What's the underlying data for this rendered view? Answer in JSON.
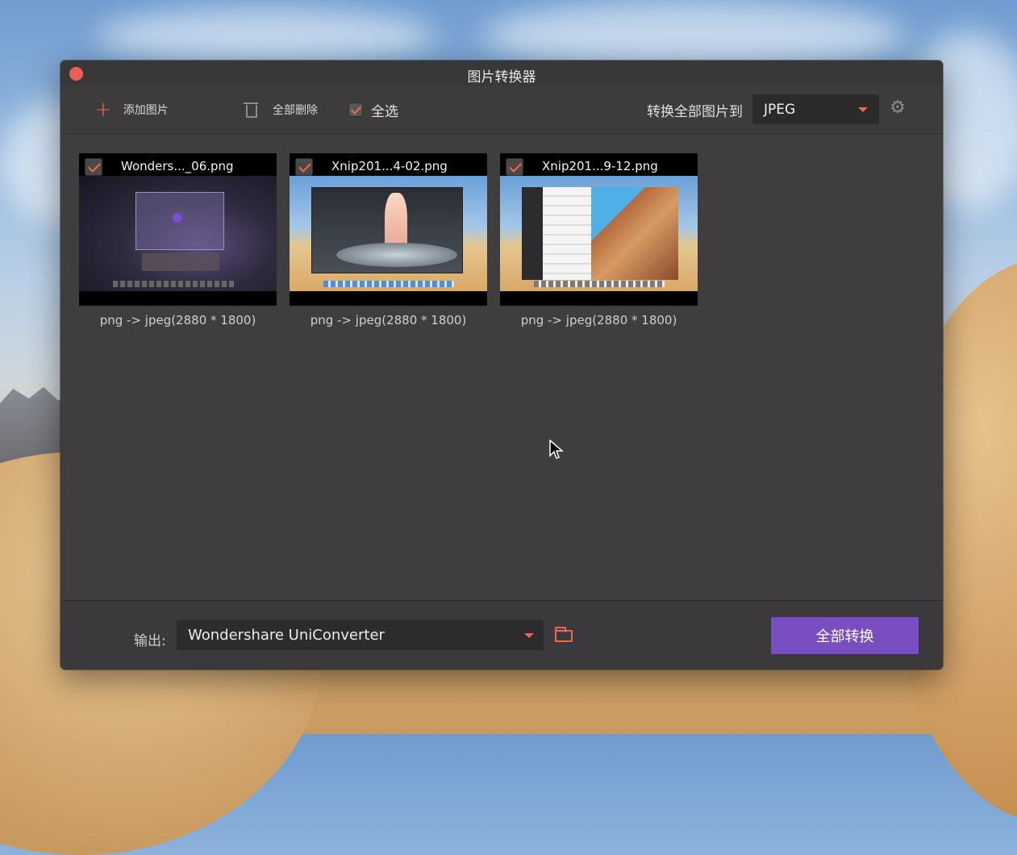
{
  "window": {
    "title": "图片转换器"
  },
  "toolbar": {
    "add_label": "添加图片",
    "delete_all_label": "全部删除",
    "select_all_label": "全选",
    "select_all_checked": true,
    "convert_all_to_label": "转换全部图片到",
    "format_value": "JPEG",
    "accent_color": "#ea6a4f"
  },
  "images": [
    {
      "name": "Wonders..._06.png",
      "checked": true,
      "info": "png -> jpeg(2880 * 1800)"
    },
    {
      "name": "Xnip201...4-02.png",
      "checked": true,
      "info": "png -> jpeg(2880 * 1800)"
    },
    {
      "name": "Xnip201...9-12.png",
      "checked": true,
      "info": "png -> jpeg(2880 * 1800)"
    }
  ],
  "footer": {
    "output_label": "输出:",
    "output_value": "Wondershare UniConverter",
    "convert_all_label": "全部转换",
    "button_color": "#7a4ec3"
  },
  "icons": [
    "close-icon",
    "plus-icon",
    "trash-icon",
    "checkbox-icon",
    "chevron-down-icon",
    "gear-icon",
    "folder-icon",
    "cursor-icon"
  ]
}
